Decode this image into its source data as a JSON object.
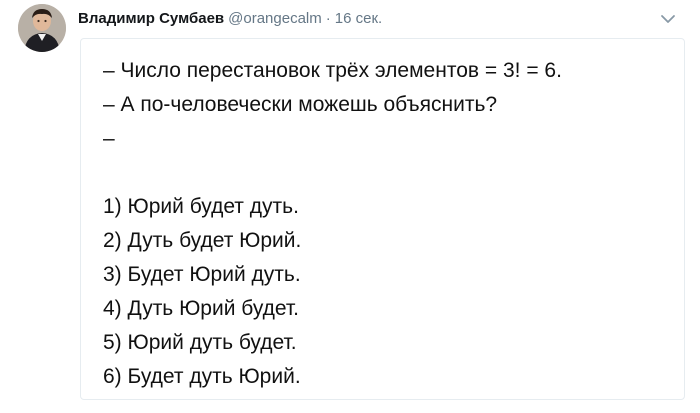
{
  "author": {
    "name": "Владимир Сумбаев",
    "handle": "@orangecalm",
    "separator": "·",
    "time": "16 сек."
  },
  "icons": {
    "avatar": "user-avatar",
    "menu": "chevron-down-icon"
  },
  "colors": {
    "name": "#14171a",
    "meta": "#657786",
    "text": "#111111",
    "border": "#e6ecf0"
  },
  "tweet": {
    "lines": [
      "– Число перестановок трёх элементов = 3! = 6.",
      "– А по-человечески можешь объяснить?",
      "–",
      "",
      "1) Юрий будет дуть.",
      "2) Дуть будет Юрий.",
      "3) Будет Юрий дуть.",
      "4) Дуть Юрий будет.",
      "5) Юрий дуть будет.",
      "6) Будет дуть Юрий."
    ]
  }
}
